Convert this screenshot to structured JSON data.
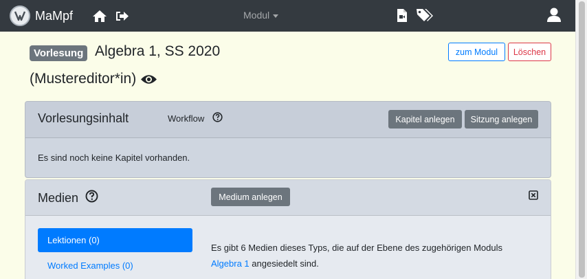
{
  "navbar": {
    "brand": "MaMpf",
    "modul_dropdown": "Modul"
  },
  "header": {
    "badge": "Vorlesung",
    "title": "Algebra 1, SS 2020",
    "subtitle": "(Mustereditor*in)",
    "to_module_button": "zum Modul",
    "delete_button": "Löschen"
  },
  "content_card": {
    "title": "Vorlesungsinhalt",
    "workflow_label": "Workflow",
    "add_chapter_button": "Kapitel anlegen",
    "add_session_button": "Sitzung anlegen",
    "empty_text": "Es sind noch keine Kapitel vorhanden."
  },
  "media_card": {
    "title": "Medien",
    "add_medium_button": "Medium anlegen",
    "tabs": [
      {
        "label": "Lektionen (0)",
        "active": true
      },
      {
        "label": "Worked Examples (0)",
        "active": false
      }
    ],
    "info_prefix": "Es gibt 6 Medien dieses Typs, die auf der Ebene des zugehörigen Moduls",
    "info_link": "Algebra 1",
    "info_suffix": "angesiedelt sind."
  },
  "colors": {
    "navbar": "#343a40",
    "page_bg": "#fbfde9",
    "primary": "#007bff",
    "danger": "#dc3545",
    "secondary": "#6c757d"
  }
}
